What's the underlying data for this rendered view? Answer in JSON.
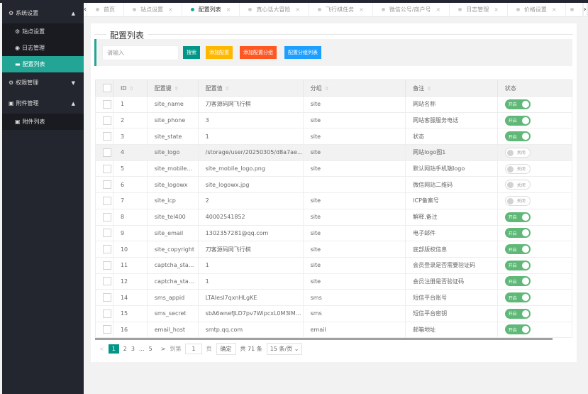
{
  "sidebar": {
    "groups": [
      {
        "label": "系统设置",
        "icon": "gears-icon",
        "expanded": true,
        "items": [
          {
            "label": "站点设置",
            "icon": "gears-icon"
          },
          {
            "label": "日志管理",
            "icon": "life-ring-icon"
          },
          {
            "label": "配置列表",
            "icon": "list-icon",
            "active": true
          }
        ]
      },
      {
        "label": "权限管理",
        "icon": "gear-icon",
        "expanded": false,
        "items": []
      },
      {
        "label": "附件管理",
        "icon": "image-icon",
        "expanded": true,
        "items": [
          {
            "label": "附件列表",
            "icon": "image-icon"
          }
        ]
      }
    ]
  },
  "tabs": [
    "首页",
    "站点设置",
    "配置列表",
    "真心话大冒险",
    "飞行棋任务",
    "微信公号/商户号",
    "日志管理",
    "价格设置",
    ""
  ],
  "active_tab": 2,
  "page": {
    "title": "配置列表"
  },
  "toolbar": {
    "placeholder": "请输入",
    "search": "搜索",
    "add_config": "添加配置",
    "add_group": "添加配置分组",
    "group_list": "配置分组列表"
  },
  "colors": {
    "accent": "#23a595",
    "yellow": "#ffb800",
    "orange": "#ff5722",
    "blue": "#1e9fff",
    "switch_on": "#5fb878"
  },
  "table": {
    "headers": [
      "ID",
      "配置键",
      "配置值",
      "分组",
      "备注",
      "状态"
    ],
    "rows": [
      {
        "id": "1",
        "key": "site_name",
        "value": "刀客源码网飞行棋",
        "group": "site",
        "remark": "网站名称",
        "status": true
      },
      {
        "id": "2",
        "key": "site_phone",
        "value": "3",
        "group": "site",
        "remark": "网站客服服务电话",
        "status": true
      },
      {
        "id": "3",
        "key": "site_state",
        "value": "1",
        "group": "site",
        "remark": "状态",
        "status": true
      },
      {
        "id": "4",
        "key": "site_logo",
        "value": "/storage/user/20250305/d8a7ae...",
        "group": "site",
        "remark": "网站logo图1",
        "status": false
      },
      {
        "id": "5",
        "key": "site_mobile...",
        "value": "site_mobile_logo.png",
        "group": "site",
        "remark": "默认网站手机端logo",
        "status": false
      },
      {
        "id": "6",
        "key": "site_logowx",
        "value": "site_logowx.jpg",
        "group": "",
        "remark": "微信网站二维码",
        "status": false
      },
      {
        "id": "7",
        "key": "site_icp",
        "value": "2",
        "group": "site",
        "remark": "ICP备案号",
        "status": false
      },
      {
        "id": "8",
        "key": "site_tel400",
        "value": "40002541852",
        "group": "site",
        "remark": "解释,备注",
        "status": true
      },
      {
        "id": "9",
        "key": "site_email",
        "value": "1302357281@qq.com",
        "group": "site",
        "remark": "电子邮件",
        "status": true
      },
      {
        "id": "10",
        "key": "site_copyright",
        "value": "刀客源码网飞行棋",
        "group": "site",
        "remark": "底部版权信息",
        "status": true
      },
      {
        "id": "11",
        "key": "captcha_sta...",
        "value": "1",
        "group": "site",
        "remark": "会员登录是否需要验证码",
        "status": true
      },
      {
        "id": "12",
        "key": "captcha_sta...",
        "value": "1",
        "group": "site",
        "remark": "会员注册是否验证码",
        "status": true
      },
      {
        "id": "14",
        "key": "sms_appid",
        "value": "LTAIesI7qxnHLgKE",
        "group": "sms",
        "remark": "短信平台账号",
        "status": true
      },
      {
        "id": "15",
        "key": "sms_secret",
        "value": "sbA6wnefJLD7pv7WipcxL0M3IM...",
        "group": "sms",
        "remark": "短信平台密钥",
        "status": true
      },
      {
        "id": "16",
        "key": "email_host",
        "value": "smtp.qq.com",
        "group": "email",
        "remark": "邮箱地址",
        "status": true
      }
    ],
    "on_label": "开启",
    "off_label": "关闭"
  },
  "pagination": {
    "prev": "<",
    "pages": [
      "1",
      "2",
      "3",
      "...",
      "5"
    ],
    "current": "1",
    "next": ">",
    "goto_label": "到第",
    "goto_value": "1",
    "page_unit": "页",
    "confirm": "确定",
    "total": "共 71 条",
    "page_size": "15 条/页"
  }
}
